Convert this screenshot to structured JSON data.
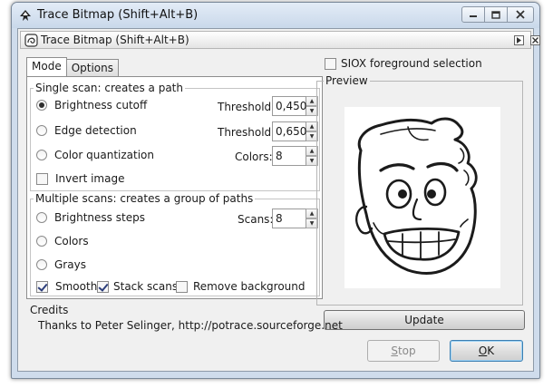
{
  "window": {
    "title": "Trace Bitmap (Shift+Alt+B)"
  },
  "dock": {
    "title": "Trace Bitmap (Shift+Alt+B)"
  },
  "tabs": [
    {
      "label": "Mode",
      "active": true
    },
    {
      "label": "Options",
      "active": false
    }
  ],
  "single_scan": {
    "legend": "Single scan: creates a path",
    "brightness_cutoff": {
      "label": "Brightness cutoff",
      "selected": true,
      "param_label": "Threshold:",
      "value": "0,450"
    },
    "edge_detection": {
      "label": "Edge detection",
      "selected": false,
      "param_label": "Threshold:",
      "value": "0,650"
    },
    "color_quantization": {
      "label": "Color quantization",
      "selected": false,
      "param_label": "Colors:",
      "value": "8"
    },
    "invert_image": {
      "label": "Invert image",
      "checked": false
    }
  },
  "multiple_scans": {
    "legend": "Multiple scans: creates a group of paths",
    "brightness_steps": {
      "label": "Brightness steps",
      "selected": false,
      "param_label": "Scans:",
      "value": "8"
    },
    "colors": {
      "label": "Colors",
      "selected": false
    },
    "grays": {
      "label": "Grays",
      "selected": false
    },
    "smooth": {
      "label": "Smooth",
      "checked": true
    },
    "stack_scans": {
      "label": "Stack scans",
      "checked": true
    },
    "remove_background": {
      "label": "Remove background",
      "checked": false
    }
  },
  "siox": {
    "label": "SIOX foreground selection",
    "checked": false
  },
  "preview": {
    "legend": "Preview"
  },
  "credits": {
    "heading": "Credits",
    "text": "Thanks to Peter Selinger, http://potrace.sourceforge.net"
  },
  "buttons": {
    "update": "Update",
    "stop_prefix": "S",
    "stop_rest": "top",
    "ok_prefix": "O",
    "ok_rest": "K"
  },
  "icons": {
    "app": "inkscape-logo-icon",
    "dock": "trace-bitmap-icon",
    "minimize": "minimize-icon",
    "maximize": "maximize-icon",
    "close": "close-icon"
  }
}
